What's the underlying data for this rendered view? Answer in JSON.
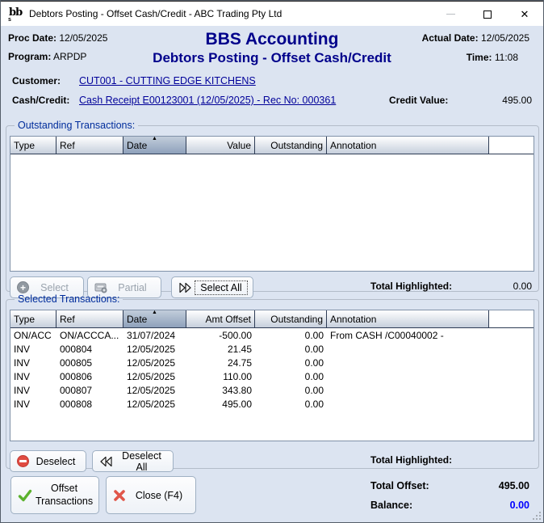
{
  "window": {
    "title": "Debtors Posting - Offset Cash/Credit - ABC Trading Pty Ltd",
    "icon": "bbs-logo",
    "icon_text_main": "bb",
    "icon_text_small": "s"
  },
  "header": {
    "proc_date_label": "Proc Date:",
    "proc_date": "12/05/2025",
    "program_label": "Program:",
    "program": "ARPDP",
    "app_title": "BBS Accounting",
    "screen_title": "Debtors Posting - Offset Cash/Credit",
    "actual_date_label": "Actual Date:",
    "actual_date": "12/05/2025",
    "time_label": "Time:",
    "time": "11:08"
  },
  "customer": {
    "label": "Customer:",
    "value": "CUT001 - CUTTING EDGE KITCHENS"
  },
  "cash_credit": {
    "label": "Cash/Credit:",
    "value": "Cash Receipt E00123001 (12/05/2025) - Rec No: 000361",
    "credit_value_label": "Credit Value:",
    "credit_value": "495.00"
  },
  "outstanding": {
    "group_label": "Outstanding Transactions:",
    "columns": [
      "Type",
      "Ref",
      "Date",
      "Value",
      "Outstanding",
      "Annotation"
    ],
    "sort_icon": "▲",
    "rows": [],
    "select_label": "Select",
    "partial_label": "Partial",
    "select_all_label": "Select All",
    "total_highlighted_label": "Total Highlighted:",
    "total_highlighted": "0.00"
  },
  "selected": {
    "group_label": "Selected Transactions:",
    "columns": [
      "Type",
      "Ref",
      "Date",
      "Amt Offset",
      "Outstanding",
      "Annotation"
    ],
    "sort_icon": "▲",
    "rows": [
      {
        "type": "ON/ACC",
        "ref": "ON/ACCCA...",
        "date": "31/07/2024",
        "amt": "-500.00",
        "outstanding": "0.00",
        "annotation": "From CASH  /C00040002 -"
      },
      {
        "type": "INV",
        "ref": "000804",
        "date": "12/05/2025",
        "amt": "21.45",
        "outstanding": "0.00",
        "annotation": ""
      },
      {
        "type": "INV",
        "ref": "000805",
        "date": "12/05/2025",
        "amt": "24.75",
        "outstanding": "0.00",
        "annotation": ""
      },
      {
        "type": "INV",
        "ref": "000806",
        "date": "12/05/2025",
        "amt": "110.00",
        "outstanding": "0.00",
        "annotation": ""
      },
      {
        "type": "INV",
        "ref": "000807",
        "date": "12/05/2025",
        "amt": "343.80",
        "outstanding": "0.00",
        "annotation": ""
      },
      {
        "type": "INV",
        "ref": "000808",
        "date": "12/05/2025",
        "amt": "495.00",
        "outstanding": "0.00",
        "annotation": ""
      }
    ],
    "deselect_label": "Deselect",
    "deselect_all_label": "Deselect All",
    "total_highlighted_label": "Total Highlighted:",
    "total_highlighted": ""
  },
  "footer": {
    "offset_button_label": "Offset Transactions",
    "close_button_label": "Close (F4)",
    "total_offset_label": "Total Offset:",
    "total_offset": "495.00",
    "balance_label": "Balance:",
    "balance": "0.00"
  },
  "colors": {
    "title_navy": "#00008B",
    "link_navy": "#000099",
    "balance_blue": "#0000FF",
    "check_green": "#5cb22e",
    "cross_red": "#e0564a",
    "window_bg": "#dce4f1"
  }
}
